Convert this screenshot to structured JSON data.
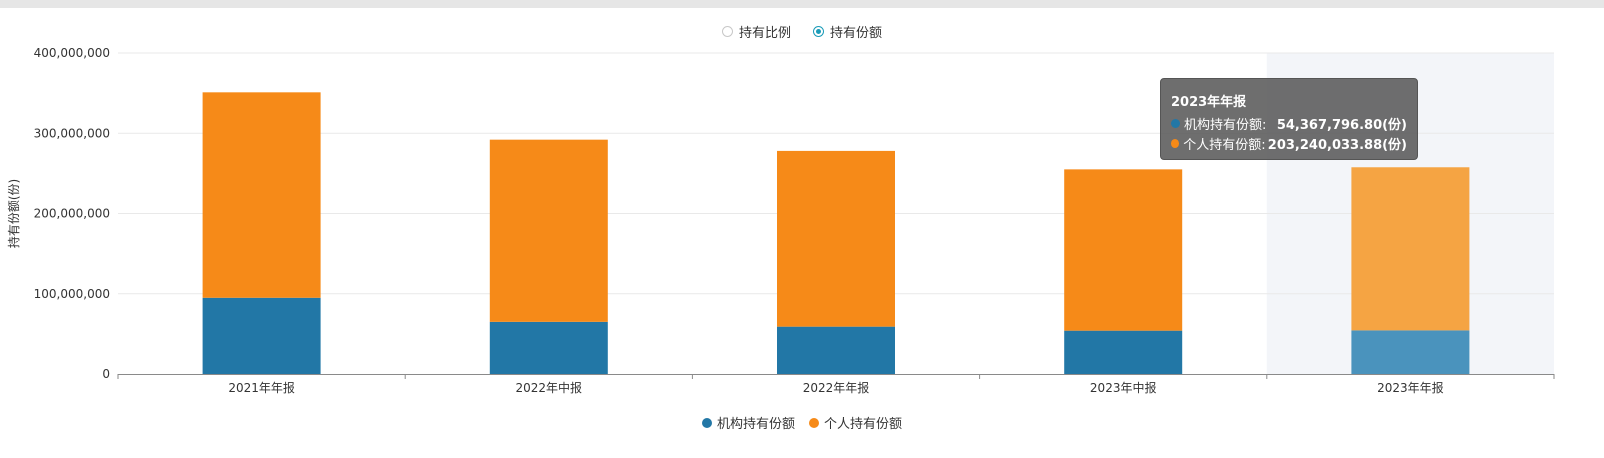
{
  "toggle": {
    "options": [
      {
        "label": "持有比例",
        "selected": false
      },
      {
        "label": "持有份额",
        "selected": true
      }
    ]
  },
  "chart_data": {
    "type": "bar",
    "stacked": true,
    "categories": [
      "2021年年报",
      "2022年中报",
      "2022年年报",
      "2023年中报",
      "2023年年报"
    ],
    "series": [
      {
        "name": "机构持有份额",
        "color": "#2277a6",
        "highlight_color": "#4a93bd",
        "values": [
          95000000,
          65000000,
          59000000,
          54000000,
          54367796.8
        ]
      },
      {
        "name": "个人持有份额",
        "color": "#f68a18",
        "highlight_color": "#f5a443",
        "values": [
          256000000,
          227000000,
          219000000,
          201000000,
          203240033.88
        ]
      }
    ],
    "ylabel": "持有份额(份)",
    "ylim": [
      0,
      400000000
    ],
    "yticks": [
      "0",
      "100,000,000",
      "200,000,000",
      "300,000,000",
      "400,000,000"
    ],
    "grid": true,
    "legend_position": "bottom",
    "highlighted_category": "2023年年报"
  },
  "tooltip": {
    "title": "2023年年报",
    "rows": [
      {
        "label": "机构持有份额:",
        "value": "54,367,796.80(份)",
        "color": "#2277a6"
      },
      {
        "label": "个人持有份额:",
        "value": "203,240,033.88(份)",
        "color": "#f68a18"
      }
    ]
  }
}
